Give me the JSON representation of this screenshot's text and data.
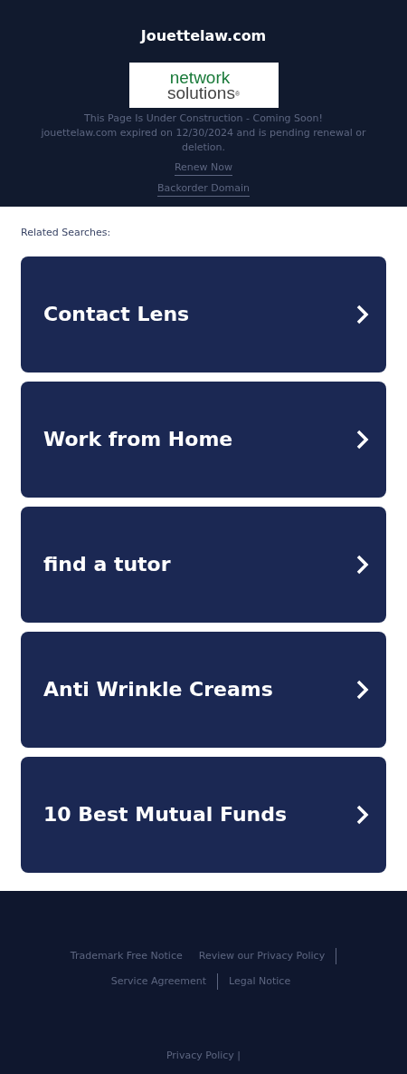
{
  "header": {
    "title": "Jouettelaw.com",
    "logo": {
      "line_1": "network",
      "line_2": "solutions",
      "mark": "®"
    },
    "notice": "This Page Is Under Construction - Coming Soon!",
    "expiry": "jouettelaw.com expired on 12/30/2024 and is pending renewal or deletion.",
    "links": [
      "Renew Now",
      "Backorder Domain"
    ]
  },
  "related": {
    "heading": "Related Searches:",
    "items": [
      {
        "label": "Contact Lens"
      },
      {
        "label": "Work from Home"
      },
      {
        "label": "find a tutor"
      },
      {
        "label": "Anti Wrinkle Creams"
      },
      {
        "label": "10 Best Mutual Funds"
      }
    ]
  },
  "footer": {
    "links": [
      {
        "label": "Trademark Free Notice",
        "divider": false
      },
      {
        "label": "Review our Privacy Policy",
        "divider": true
      },
      {
        "label": "Service Agreement",
        "divider": true
      },
      {
        "label": "Legal Notice",
        "divider": false
      }
    ],
    "bottom": "Privacy Policy |"
  }
}
